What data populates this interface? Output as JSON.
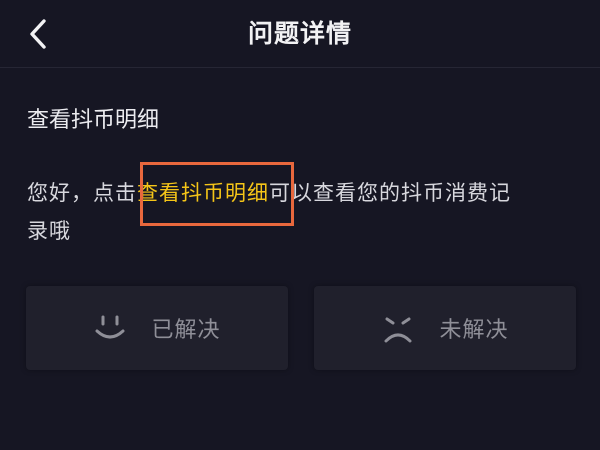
{
  "nav": {
    "title": "问题详情",
    "back_icon": "chevron-left-icon"
  },
  "question": {
    "title": "查看抖币明细"
  },
  "answer": {
    "prefix": "您好，点击",
    "link_text": "查看抖币明细",
    "suffix_line1": "可以查看您的抖币消费记",
    "suffix_line2": "录哦"
  },
  "feedback": {
    "resolved_label": "已解决",
    "resolved_icon": "smile-face-icon",
    "unresolved_label": "未解决",
    "unresolved_icon": "frown-face-icon"
  },
  "colors": {
    "background": "#161623",
    "link": "#f5c518",
    "highlight_border": "#e8683d",
    "button_bg": "#20202c",
    "button_text": "#8f8f98"
  }
}
